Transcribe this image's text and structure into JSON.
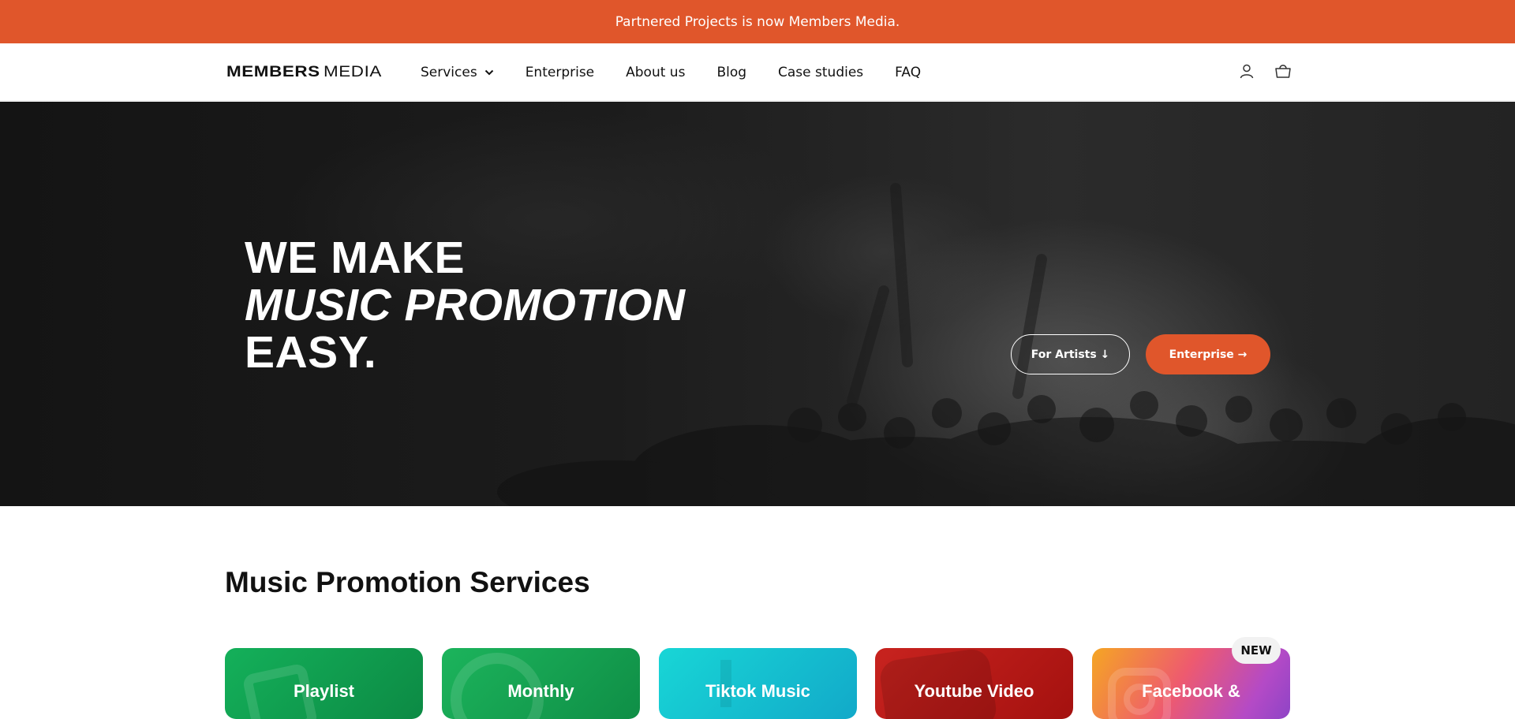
{
  "announcement": {
    "text": "Partnered Projects is now Members Media."
  },
  "header": {
    "logo_bold": "MEMBERS",
    "logo_light": "MEDIA",
    "nav": [
      {
        "label": "Services",
        "dropdown": true
      },
      {
        "label": "Enterprise"
      },
      {
        "label": "About us"
      },
      {
        "label": "Blog"
      },
      {
        "label": "Case studies"
      },
      {
        "label": "FAQ"
      }
    ],
    "icons": [
      "account-icon",
      "cart-icon"
    ]
  },
  "hero": {
    "line1": "WE MAKE",
    "line2": "MUSIC PROMOTION",
    "line3": "EASY.",
    "btn_artists": "For Artists ↓",
    "btn_enterprise": "Enterprise →"
  },
  "services": {
    "title": "Music Promotion Services",
    "badge": "NEW",
    "cards": [
      {
        "label": "Playlist"
      },
      {
        "label": "Monthly"
      },
      {
        "label": "Tiktok Music"
      },
      {
        "label": "Youtube Video"
      },
      {
        "label": "Facebook &"
      }
    ]
  },
  "colors": {
    "accent": "#e0562b",
    "text": "#111111"
  }
}
